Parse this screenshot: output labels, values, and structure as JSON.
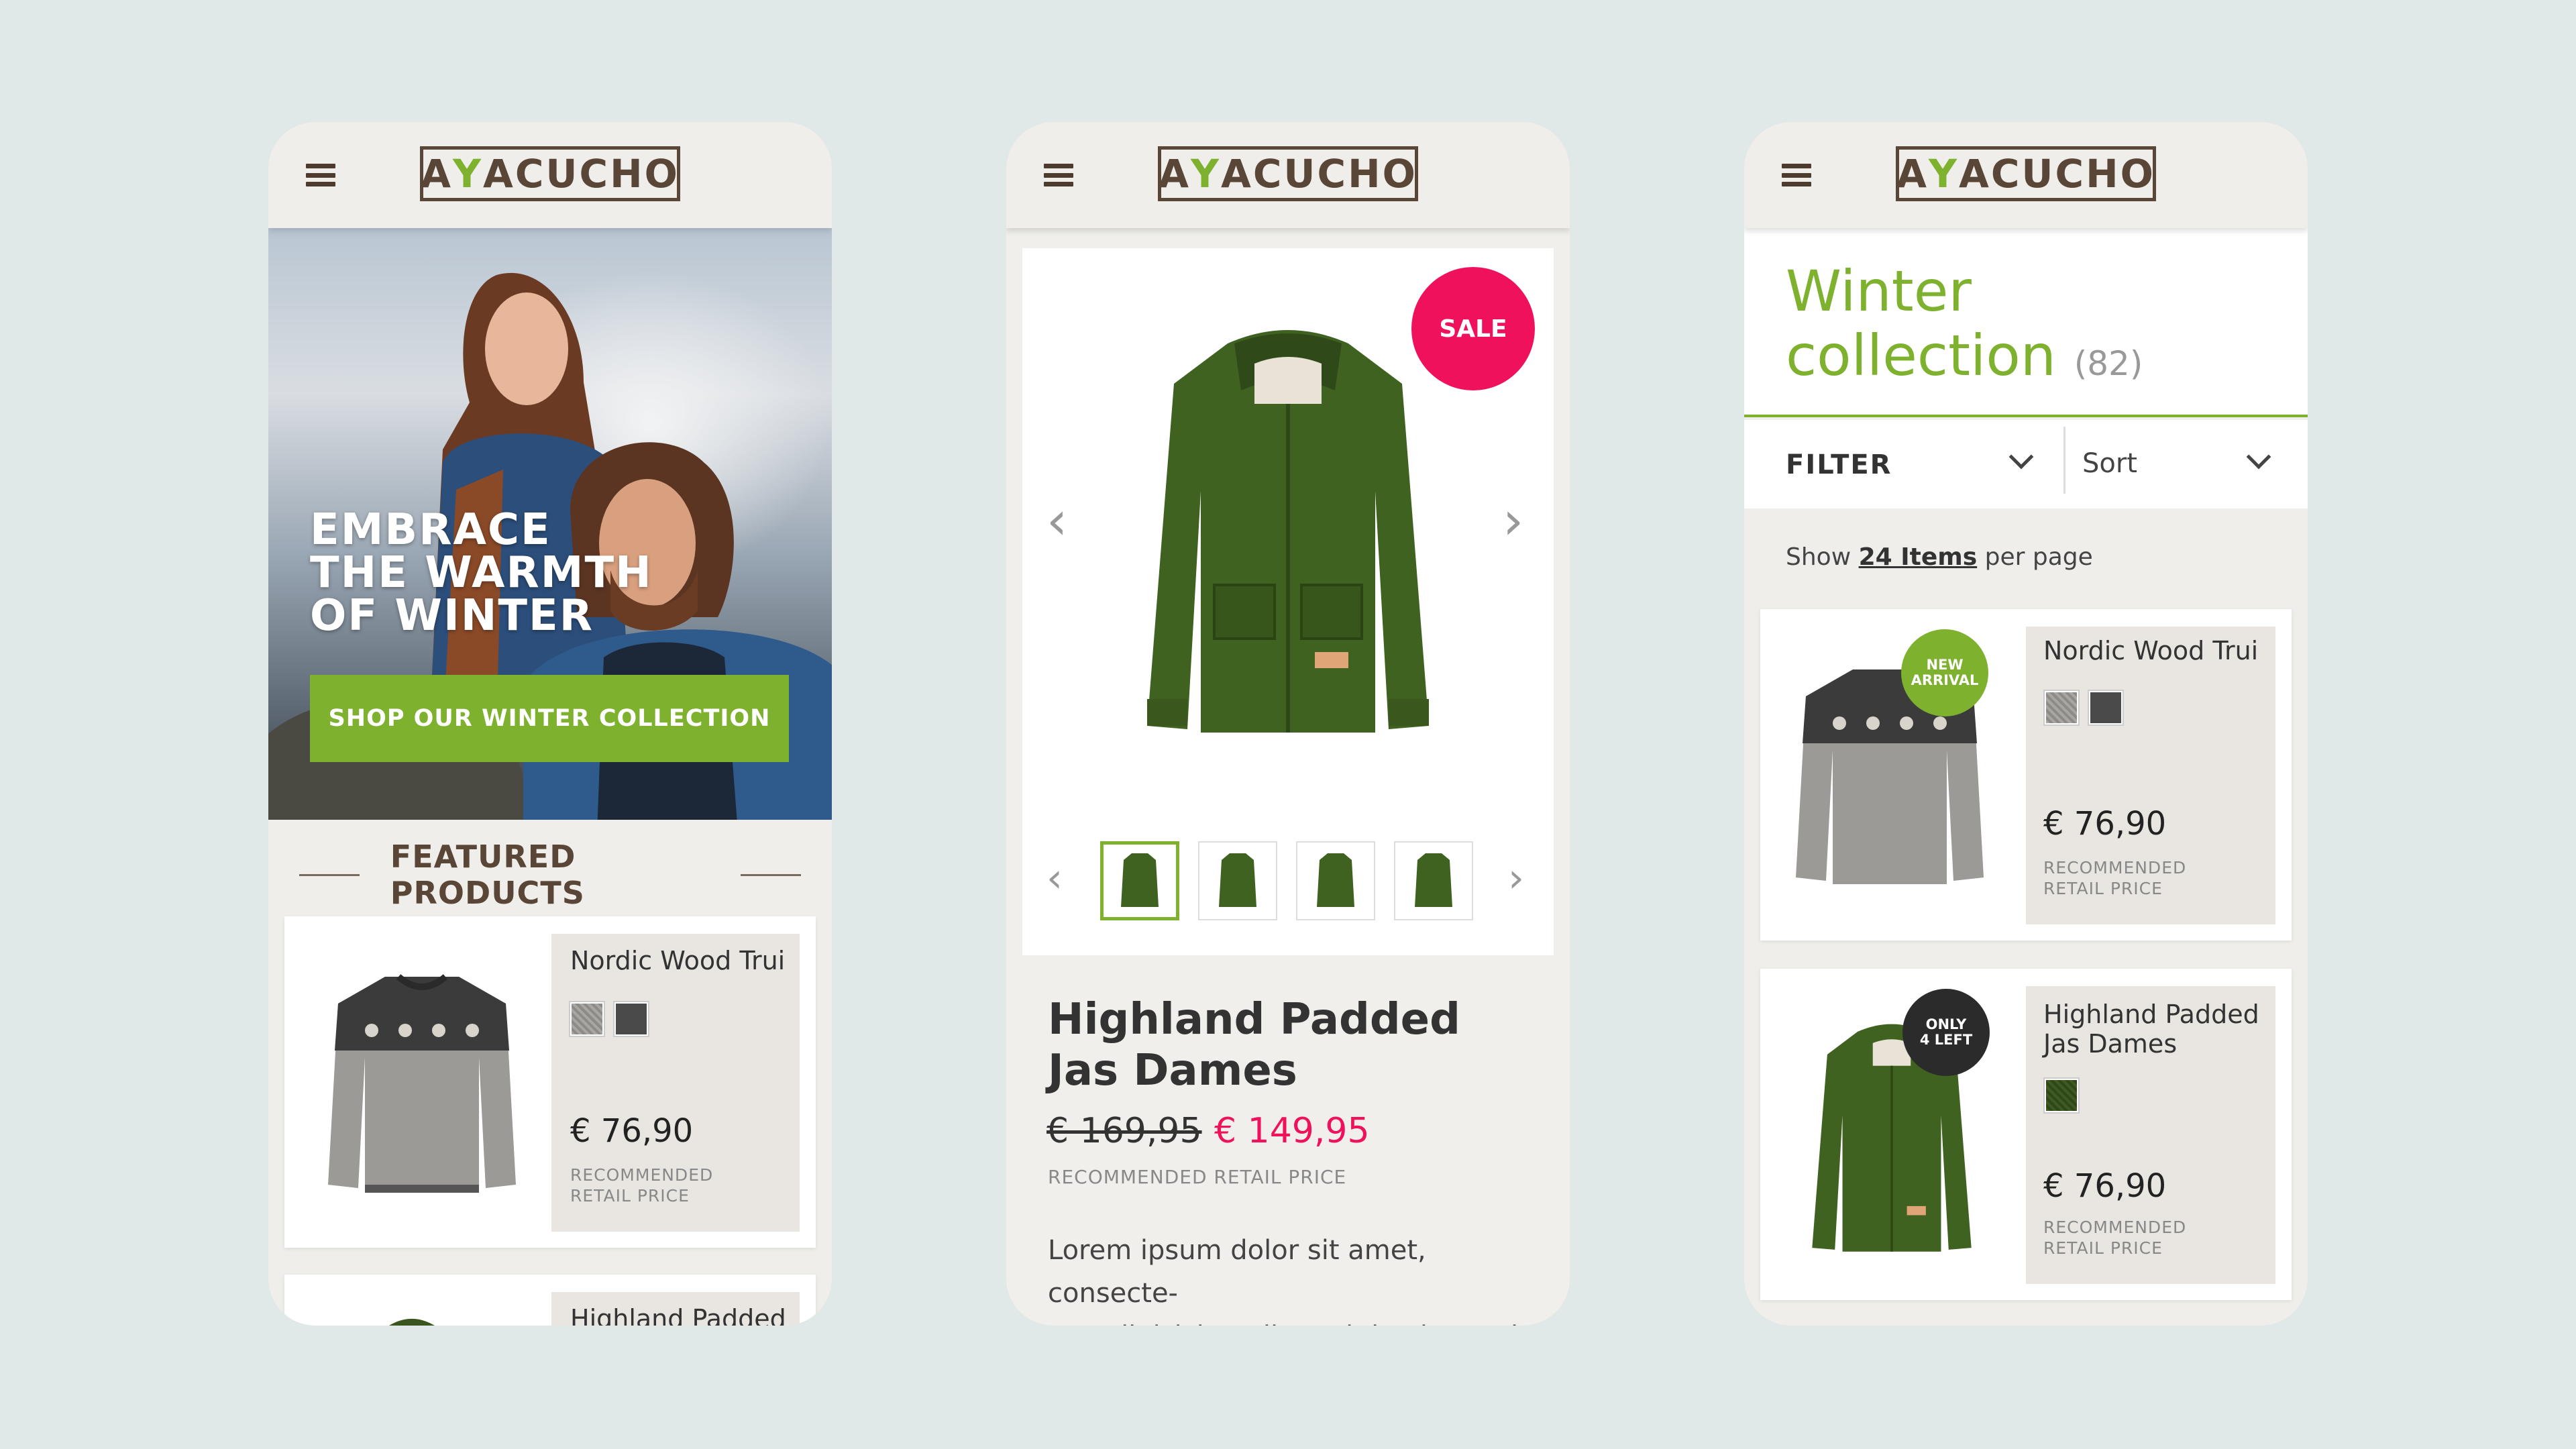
{
  "brand": {
    "logo_pre": "A",
    "logo_y": "Y",
    "logo_post": "ACUCHO",
    "accent": "#7db12e",
    "sale_color": "#f0115d"
  },
  "home": {
    "hero_lines": [
      "EMBRACE",
      "THE WARMTH",
      "OF WINTER"
    ],
    "hero_button": "SHOP OUR WINTER COLLECTION",
    "featured_title": "FEATURED PRODUCTS",
    "products": [
      {
        "name": "Nordic Wood Trui",
        "price": "€ 76,90",
        "rrp_line1": "RECOMMENDED",
        "rrp_line2": "RETAIL PRICE"
      },
      {
        "name": "Highland Padded"
      }
    ]
  },
  "product": {
    "sale_badge": "SALE",
    "name_line1": "Highland Padded",
    "name_line2": "Jas Dames",
    "old_price": "€ 169,95",
    "new_price": "€ 149,95",
    "rrp": "RECOMMENDED RETAIL PRICE",
    "desc_line1": "Lorem ipsum dolor sit amet, consecte-",
    "desc_line2": "tur adipisicing elit, sed do eiusmod"
  },
  "collection": {
    "title_line1": "Winter",
    "title_line2": "collection",
    "count": "(82)",
    "filter": "FILTER",
    "sort": "Sort",
    "show": "Show",
    "items_per_page": "24 Items",
    "per_page": "per page",
    "products": [
      {
        "name": "Nordic Wood Trui",
        "badge_line1": "NEW",
        "badge_line2": "ARRIVAL",
        "price": "€ 76,90",
        "rrp_line1": "RECOMMENDED",
        "rrp_line2": "RETAIL PRICE"
      },
      {
        "name_line1": "Highland Padded",
        "name_line2": "Jas Dames",
        "badge_line1": "ONLY",
        "badge_line2": "4 LEFT",
        "price": "€ 76,90",
        "rrp_line1": "RECOMMENDED",
        "rrp_line2": "RETAIL PRICE"
      }
    ]
  },
  "icons": {
    "menu": "hamburger-icon",
    "prev": "chevron-left-icon",
    "next": "chevron-right-icon",
    "dropdown": "chevron-down-icon"
  }
}
